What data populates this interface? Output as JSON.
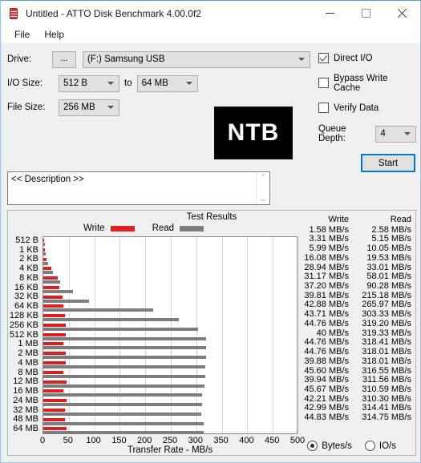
{
  "window": {
    "title": "Untitled - ATTO Disk Benchmark 4.00.0f2",
    "icon": "disk-drum-icon",
    "minimize": "—",
    "maximize": "□",
    "close": "✕"
  },
  "menubar": {
    "items": [
      "File",
      "Help"
    ]
  },
  "controls": {
    "drive_label": "Drive:",
    "browse_label": "...",
    "drive_value": "(F:) Samsung USB",
    "io_size_label": "I/O Size:",
    "io_size_min": "512 B",
    "io_to_label": "to",
    "io_size_max": "64 MB",
    "file_size_label": "File Size:",
    "file_size_value": "256 MB",
    "logo_text": "NTB"
  },
  "options": {
    "direct_io_label": "Direct I/O",
    "direct_io_checked": true,
    "bypass_cache_label": "Bypass Write Cache",
    "bypass_cache_checked": false,
    "verify_data_label": "Verify Data",
    "verify_data_checked": false,
    "queue_depth_label": "Queue Depth:",
    "queue_depth_value": "4",
    "start_label": "Start"
  },
  "description": {
    "value": "<< Description >>",
    "scroll_up": "⌃",
    "scroll_down": "⌄"
  },
  "results": {
    "title": "Test Results",
    "legend_write": "Write",
    "legend_read": "Read",
    "col_write": "Write",
    "col_read": "Read",
    "unit_bytes_label": "Bytes/s",
    "unit_io_label": "IO/s",
    "unit_selected": "Bytes/s"
  },
  "colors": {
    "write": "#de1f1f",
    "read": "#7d7d7d",
    "accent": "#0078d7",
    "window_bg": "#f0f0f0"
  },
  "chart_data": {
    "type": "bar",
    "title": "Test Results",
    "xlabel": "Transfer Rate - MB/s",
    "ylabel": "",
    "orientation": "horizontal",
    "xlim": [
      0,
      500
    ],
    "xticks": [
      0,
      50,
      100,
      150,
      200,
      250,
      300,
      350,
      400,
      450,
      500
    ],
    "grid": true,
    "legend_position": "top",
    "categories": [
      "512 B",
      "1 KB",
      "2 KB",
      "4 KB",
      "8 KB",
      "16 KB",
      "32 KB",
      "64 KB",
      "128 KB",
      "256 KB",
      "512 KB",
      "1 MB",
      "2 MB",
      "4 MB",
      "8 MB",
      "12 MB",
      "16 MB",
      "24 MB",
      "32 MB",
      "48 MB",
      "64 MB"
    ],
    "series": [
      {
        "name": "Write",
        "color": "#de1f1f",
        "unit": "MB/s",
        "values": [
          1.58,
          3.31,
          5.99,
          16.08,
          28.94,
          31.17,
          37.2,
          39.81,
          42.88,
          43.71,
          44.76,
          40,
          44.76,
          44.76,
          39.88,
          45.6,
          39.94,
          45.67,
          42.21,
          42.99,
          44.83
        ],
        "labels": [
          "1.58 MB/s",
          "3.31 MB/s",
          "5.99 MB/s",
          "16.08 MB/s",
          "28.94 MB/s",
          "31.17 MB/s",
          "37.20 MB/s",
          "39.81 MB/s",
          "42.88 MB/s",
          "43.71 MB/s",
          "44.76 MB/s",
          "40 MB/s",
          "44.76 MB/s",
          "44.76 MB/s",
          "39.88 MB/s",
          "45.60 MB/s",
          "39.94 MB/s",
          "45.67 MB/s",
          "42.21 MB/s",
          "42.99 MB/s",
          "44.83 MB/s"
        ]
      },
      {
        "name": "Read",
        "color": "#7d7d7d",
        "unit": "MB/s",
        "values": [
          2.58,
          5.15,
          10.05,
          19.53,
          33.01,
          58.01,
          90.28,
          215.18,
          265.97,
          303.33,
          319.2,
          319.33,
          318.41,
          318.01,
          318.01,
          316.55,
          311.56,
          310.59,
          310.3,
          314.41,
          314.75
        ],
        "labels": [
          "2.58 MB/s",
          "5.15 MB/s",
          "10.05 MB/s",
          "19.53 MB/s",
          "33.01 MB/s",
          "58.01 MB/s",
          "90.28 MB/s",
          "215.18 MB/s",
          "265.97 MB/s",
          "303.33 MB/s",
          "319.20 MB/s",
          "319.33 MB/s",
          "318.41 MB/s",
          "318.01 MB/s",
          "318.01 MB/s",
          "316.55 MB/s",
          "311.56 MB/s",
          "310.59 MB/s",
          "310.30 MB/s",
          "314.41 MB/s",
          "314.75 MB/s"
        ]
      }
    ]
  }
}
